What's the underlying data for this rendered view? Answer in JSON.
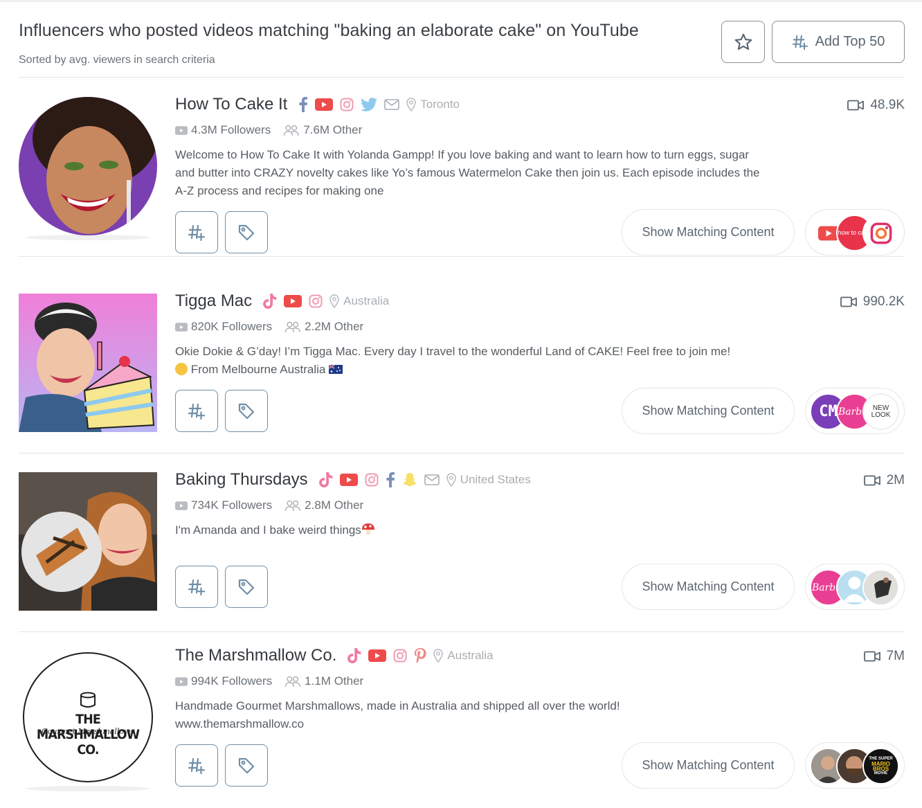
{
  "header": {
    "title": "Influencers who posted videos matching \"baking an elaborate cake\" on YouTube",
    "subtitle": "Sorted by avg. viewers in search criteria",
    "add_button_label": "Add Top 50",
    "favorite_icon": "star-icon",
    "add_icon": "hashtag-plus-icon"
  },
  "colors": {
    "youtube": "#ee4b4b",
    "instagram": "#f29bb0",
    "facebook": "#7b8fb8",
    "twitter": "#8ec9ef",
    "tiktok": "#f07aa0",
    "pinterest": "#ef8a8a",
    "snapchat": "#f7e067",
    "muted": "#a9aeb3",
    "accent_border": "#6f8fa8"
  },
  "influencers": [
    {
      "name": "How To Cake It",
      "location": "Toronto",
      "socials": [
        "facebook-icon",
        "youtube-icon",
        "instagram-icon",
        "twitter-icon",
        "email-icon"
      ],
      "followers": "4.3M Followers",
      "other": "7.6M Other",
      "description": "Welcome to How To Cake It with Yolanda Gampp! If you love baking and want to learn how to turn eggs, sugar and butter into CRAZY novelty cakes like Yo’s famous Watermelon Cake then join us. Each episode includes the A-Z process and recipes for making one",
      "views": "48.9K",
      "show_label": "Show Matching Content",
      "brand_logo_text": "how to cake"
    },
    {
      "name": "Tigga Mac",
      "location": "Australia",
      "socials": [
        "tiktok-icon",
        "youtube-icon",
        "instagram-icon"
      ],
      "followers": "820K Followers",
      "other": "2.2M Other",
      "description": "Okie Dokie & G’day! I’m Tigga Mac. Every day I travel to the wonderful Land of CAKE! Feel free to join me!",
      "description_line2": "From Melbourne Australia",
      "views": "990.2K",
      "show_label": "Show Matching Content",
      "brand_logo_text_1": "CM",
      "brand_logo_text_2": "Barbie",
      "brand_logo_text_3a": "NEW",
      "brand_logo_text_3b": "LOOK"
    },
    {
      "name": "Baking Thursdays",
      "location": "United States",
      "socials": [
        "tiktok-icon",
        "youtube-icon",
        "instagram-icon",
        "facebook-icon",
        "snapchat-icon",
        "email-icon"
      ],
      "followers": "734K Followers",
      "other": "2.8M Other",
      "description": "I'm Amanda and I bake weird things",
      "views": "2M",
      "show_label": "Show Matching Content",
      "brand_logo_text_1": "Barbie"
    },
    {
      "name": "The Marshmallow Co.",
      "location": "Australia",
      "socials": [
        "tiktok-icon",
        "youtube-icon",
        "instagram-icon",
        "pinterest-icon"
      ],
      "followers": "994K Followers",
      "other": "1.1M Other",
      "description": "Handmade Gourmet Marshmallows, made in Australia and shipped all over the world!",
      "url": "www.themarshmallow.co",
      "views": "7M",
      "show_label": "Show Matching Content",
      "logo_line1": "THE MARSHMALLOW CO.",
      "logo_line2": "Gourmet Marshmallows",
      "brand_logo_text_3a": "THE SUPER",
      "brand_logo_text_3b": "MARIO BROS",
      "brand_logo_text_3c": "MOVIE"
    }
  ]
}
